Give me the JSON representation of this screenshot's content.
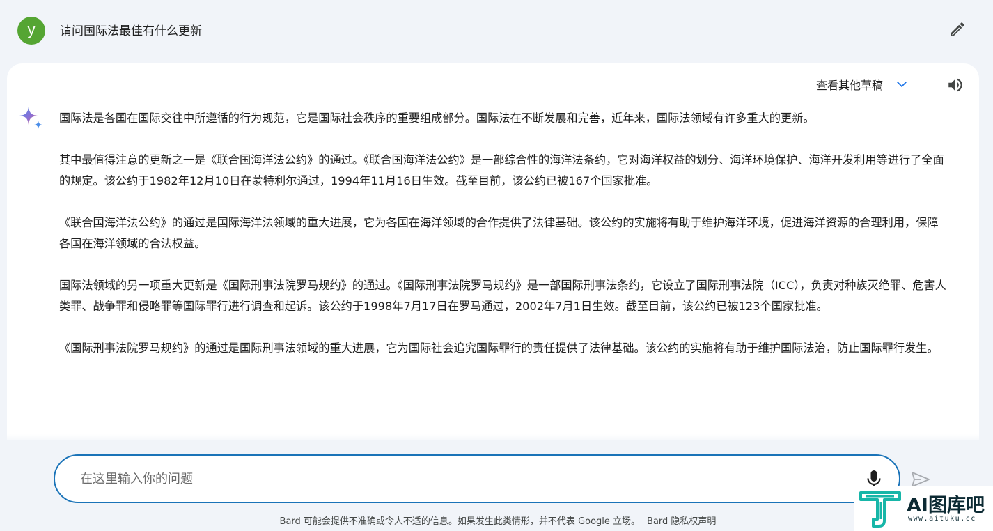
{
  "prompt": {
    "avatar_letter": "y",
    "text": "请问国际法最佳有什么更新"
  },
  "response": {
    "view_drafts_label": "查看其他草稿",
    "paragraphs": [
      "国际法是各国在国际交往中所遵循的行为规范，它是国际社会秩序的重要组成部分。国际法在不断发展和完善，近年来，国际法领域有许多重大的更新。",
      "其中最值得注意的更新之一是《联合国海洋法公约》的通过。《联合国海洋法公约》是一部综合性的海洋法条约，它对海洋权益的划分、海洋环境保护、海洋开发利用等进行了全面的规定。该公约于1982年12月10日在蒙特利尔通过，1994年11月16日生效。截至目前，该公约已被167个国家批准。",
      "《联合国海洋法公约》的通过是国际海洋法领域的重大进展，它为各国在海洋领域的合作提供了法律基础。该公约的实施将有助于维护海洋环境，促进海洋资源的合理利用，保障各国在海洋领域的合法权益。",
      "国际法领域的另一项重大更新是《国际刑事法院罗马规约》的通过。《国际刑事法院罗马规约》是一部国际刑事法条约，它设立了国际刑事法院（ICC），负责对种族灭绝罪、危害人类罪、战争罪和侵略罪等国际罪行进行调查和起诉。该公约于1998年7月17日在罗马通过，2002年7月1日生效。截至目前，该公约已被123个国家批准。",
      "《国际刑事法院罗马规约》的通过是国际刑事法领域的重大进展，它为国际社会追究国际罪行的责任提供了法律基础。该公约的实施将有助于维护国际法治，防止国际罪行发生。"
    ]
  },
  "input": {
    "placeholder": "在这里输入你的问题",
    "value": ""
  },
  "footer": {
    "disclaimer": "Bard 可能会提供不准确或令人不适的信息。如果发生此类情形，并不代表 Google 立场。",
    "privacy_link": "Bard 隐私权声明"
  },
  "watermark": {
    "title": "AI图库吧",
    "url": "www.aituku.cc"
  },
  "icons": {
    "edit": "pencil-icon",
    "drafts": "chevron-down-icon",
    "speaker": "speaker-icon",
    "bard": "sparkle-icon",
    "mic": "microphone-icon",
    "send": "send-icon"
  },
  "colors": {
    "avatar": "#55a533",
    "input_border": "#1a73b8",
    "background": "#f1f4f9",
    "chevron": "#1a73e8",
    "watermark_teal": "#17b6a8"
  }
}
